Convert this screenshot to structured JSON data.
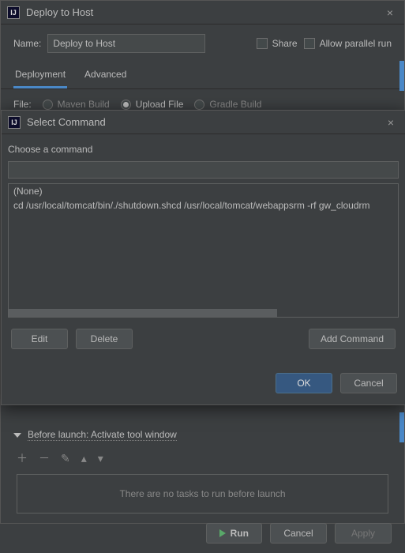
{
  "parent": {
    "title": "Deploy to Host",
    "name_label": "Name:",
    "name_value": "Deploy to Host",
    "share_label": "Share",
    "parallel_label": "Allow parallel run",
    "tabs": {
      "deployment": "Deployment",
      "advanced": "Advanced"
    },
    "file_label": "File:",
    "radios": {
      "maven": "Maven Build",
      "upload": "Upload File",
      "gradle": "Gradle Build"
    }
  },
  "modal": {
    "title": "Select Command",
    "prompt": "Choose a command",
    "items": {
      "none": "(None)",
      "cmd1": "cd /usr/local/tomcat/bin/./shutdown.shcd /usr/local/tomcat/webappsrm -rf gw_cloudrm"
    },
    "buttons": {
      "edit": "Edit",
      "delete": "Delete",
      "add": "Add Command",
      "ok": "OK",
      "cancel": "Cancel"
    }
  },
  "before_launch": {
    "header": "Before launch: Activate tool window",
    "empty": "There are no tasks to run before launch"
  },
  "bottom": {
    "run": "Run",
    "cancel": "Cancel",
    "apply": "Apply"
  }
}
